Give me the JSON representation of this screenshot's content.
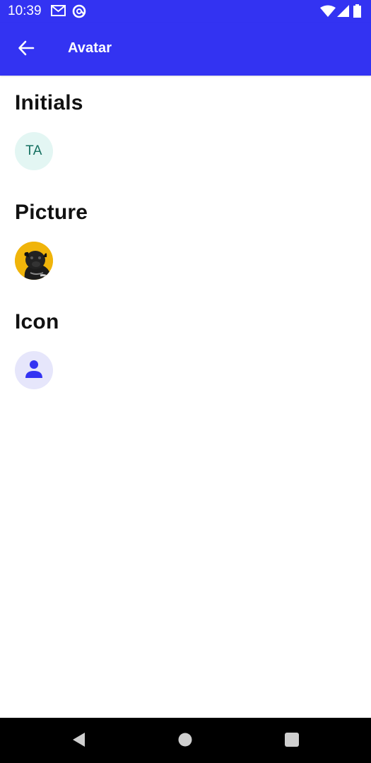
{
  "status_bar": {
    "time": "10:39",
    "icons": [
      "gmail-icon",
      "at-sign-icon",
      "wifi-icon",
      "signal-icon",
      "battery-icon"
    ]
  },
  "app_bar": {
    "title": "Avatar",
    "back_icon": "arrow-back-icon"
  },
  "sections": {
    "initials": {
      "heading": "Initials",
      "avatar_text": "TA"
    },
    "picture": {
      "heading": "Picture",
      "avatar_image": "pug-photo"
    },
    "icon": {
      "heading": "Icon",
      "avatar_icon": "person-icon"
    }
  },
  "nav_bar": {
    "buttons": [
      "back-triangle-icon",
      "home-circle-icon",
      "recents-square-icon"
    ]
  },
  "colors": {
    "brand": "#3333f2",
    "initials_avatar_bg": "#e3f6f3",
    "initials_avatar_text": "#157060",
    "picture_avatar_bg": "#f0b40a",
    "icon_avatar_bg": "#e6e6fb",
    "icon_avatar_fg": "#3333f2",
    "heading_text": "#111111"
  }
}
